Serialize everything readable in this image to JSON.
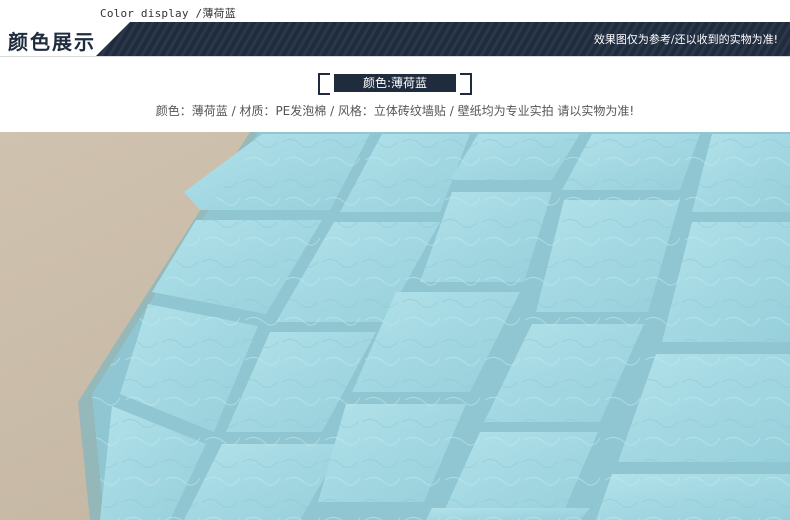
{
  "top_label": "Color display /薄荷蓝",
  "banner": {
    "title": "颜色展示",
    "note": "效果图仅为参考/还以收到的实物为准!"
  },
  "tag": {
    "label": "颜色:薄荷蓝"
  },
  "description": "颜色：薄荷蓝 / 材质：PE发泡棉 / 风格：立体砖纹墙贴 / 壁纸均为专业实拍 请以实物为准!",
  "colors": {
    "banner_dark": "#1f2c3e",
    "wall_background": "#c9bba7",
    "brick_mint": "#a6dbe5",
    "grout": "#8fc6d1"
  }
}
